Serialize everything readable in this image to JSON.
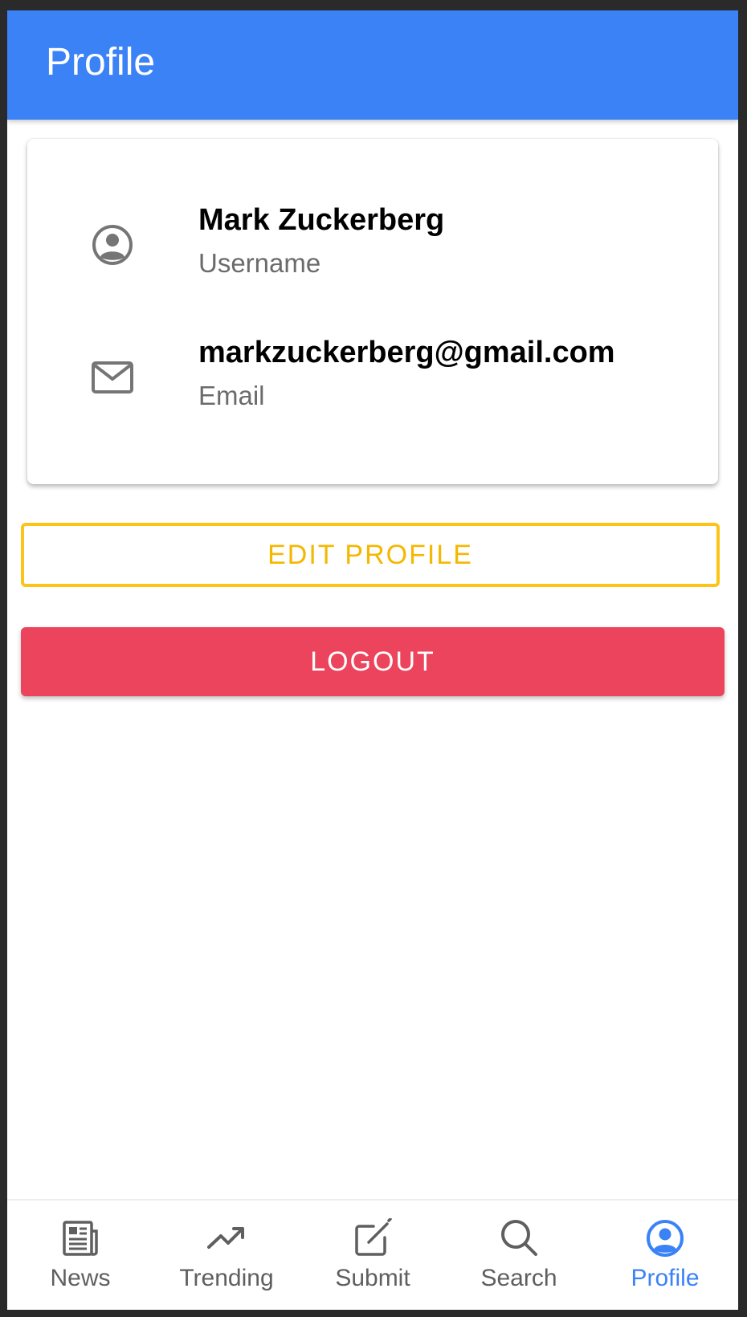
{
  "appbar": {
    "title": "Profile"
  },
  "profile": {
    "username_value": "Mark Zuckerberg",
    "username_label": "Username",
    "username_icon": "account-circle-icon",
    "email_value": "markzuckerberg@gmail.com",
    "email_label": "Email",
    "email_icon": "mail-icon"
  },
  "actions": {
    "edit_label": "EDIT PROFILE",
    "logout_label": "LOGOUT"
  },
  "bottom_nav": {
    "items": [
      {
        "label": "News",
        "icon": "newspaper-icon",
        "active": false
      },
      {
        "label": "Trending",
        "icon": "trending-up-icon",
        "active": false
      },
      {
        "label": "Submit",
        "icon": "edit-square-icon",
        "active": false
      },
      {
        "label": "Search",
        "icon": "search-icon",
        "active": false
      },
      {
        "label": "Profile",
        "icon": "account-circle-icon",
        "active": true
      }
    ]
  },
  "colors": {
    "primary": "#3b82f6",
    "warning": "#fcc419",
    "danger": "#ec445c",
    "icon_gray": "#757575"
  }
}
